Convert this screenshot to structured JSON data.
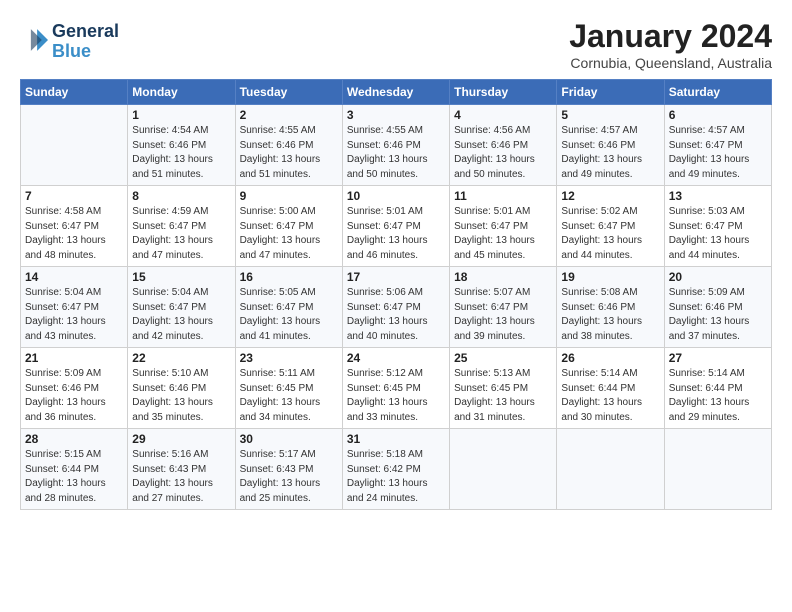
{
  "header": {
    "logo_line1": "General",
    "logo_line2": "Blue",
    "title": "January 2024",
    "subtitle": "Cornubia, Queensland, Australia"
  },
  "columns": [
    "Sunday",
    "Monday",
    "Tuesday",
    "Wednesday",
    "Thursday",
    "Friday",
    "Saturday"
  ],
  "weeks": [
    [
      {
        "day": "",
        "text": ""
      },
      {
        "day": "1",
        "text": "Sunrise: 4:54 AM\nSunset: 6:46 PM\nDaylight: 13 hours\nand 51 minutes."
      },
      {
        "day": "2",
        "text": "Sunrise: 4:55 AM\nSunset: 6:46 PM\nDaylight: 13 hours\nand 51 minutes."
      },
      {
        "day": "3",
        "text": "Sunrise: 4:55 AM\nSunset: 6:46 PM\nDaylight: 13 hours\nand 50 minutes."
      },
      {
        "day": "4",
        "text": "Sunrise: 4:56 AM\nSunset: 6:46 PM\nDaylight: 13 hours\nand 50 minutes."
      },
      {
        "day": "5",
        "text": "Sunrise: 4:57 AM\nSunset: 6:46 PM\nDaylight: 13 hours\nand 49 minutes."
      },
      {
        "day": "6",
        "text": "Sunrise: 4:57 AM\nSunset: 6:47 PM\nDaylight: 13 hours\nand 49 minutes."
      }
    ],
    [
      {
        "day": "7",
        "text": "Sunrise: 4:58 AM\nSunset: 6:47 PM\nDaylight: 13 hours\nand 48 minutes."
      },
      {
        "day": "8",
        "text": "Sunrise: 4:59 AM\nSunset: 6:47 PM\nDaylight: 13 hours\nand 47 minutes."
      },
      {
        "day": "9",
        "text": "Sunrise: 5:00 AM\nSunset: 6:47 PM\nDaylight: 13 hours\nand 47 minutes."
      },
      {
        "day": "10",
        "text": "Sunrise: 5:01 AM\nSunset: 6:47 PM\nDaylight: 13 hours\nand 46 minutes."
      },
      {
        "day": "11",
        "text": "Sunrise: 5:01 AM\nSunset: 6:47 PM\nDaylight: 13 hours\nand 45 minutes."
      },
      {
        "day": "12",
        "text": "Sunrise: 5:02 AM\nSunset: 6:47 PM\nDaylight: 13 hours\nand 44 minutes."
      },
      {
        "day": "13",
        "text": "Sunrise: 5:03 AM\nSunset: 6:47 PM\nDaylight: 13 hours\nand 44 minutes."
      }
    ],
    [
      {
        "day": "14",
        "text": "Sunrise: 5:04 AM\nSunset: 6:47 PM\nDaylight: 13 hours\nand 43 minutes."
      },
      {
        "day": "15",
        "text": "Sunrise: 5:04 AM\nSunset: 6:47 PM\nDaylight: 13 hours\nand 42 minutes."
      },
      {
        "day": "16",
        "text": "Sunrise: 5:05 AM\nSunset: 6:47 PM\nDaylight: 13 hours\nand 41 minutes."
      },
      {
        "day": "17",
        "text": "Sunrise: 5:06 AM\nSunset: 6:47 PM\nDaylight: 13 hours\nand 40 minutes."
      },
      {
        "day": "18",
        "text": "Sunrise: 5:07 AM\nSunset: 6:47 PM\nDaylight: 13 hours\nand 39 minutes."
      },
      {
        "day": "19",
        "text": "Sunrise: 5:08 AM\nSunset: 6:46 PM\nDaylight: 13 hours\nand 38 minutes."
      },
      {
        "day": "20",
        "text": "Sunrise: 5:09 AM\nSunset: 6:46 PM\nDaylight: 13 hours\nand 37 minutes."
      }
    ],
    [
      {
        "day": "21",
        "text": "Sunrise: 5:09 AM\nSunset: 6:46 PM\nDaylight: 13 hours\nand 36 minutes."
      },
      {
        "day": "22",
        "text": "Sunrise: 5:10 AM\nSunset: 6:46 PM\nDaylight: 13 hours\nand 35 minutes."
      },
      {
        "day": "23",
        "text": "Sunrise: 5:11 AM\nSunset: 6:45 PM\nDaylight: 13 hours\nand 34 minutes."
      },
      {
        "day": "24",
        "text": "Sunrise: 5:12 AM\nSunset: 6:45 PM\nDaylight: 13 hours\nand 33 minutes."
      },
      {
        "day": "25",
        "text": "Sunrise: 5:13 AM\nSunset: 6:45 PM\nDaylight: 13 hours\nand 31 minutes."
      },
      {
        "day": "26",
        "text": "Sunrise: 5:14 AM\nSunset: 6:44 PM\nDaylight: 13 hours\nand 30 minutes."
      },
      {
        "day": "27",
        "text": "Sunrise: 5:14 AM\nSunset: 6:44 PM\nDaylight: 13 hours\nand 29 minutes."
      }
    ],
    [
      {
        "day": "28",
        "text": "Sunrise: 5:15 AM\nSunset: 6:44 PM\nDaylight: 13 hours\nand 28 minutes."
      },
      {
        "day": "29",
        "text": "Sunrise: 5:16 AM\nSunset: 6:43 PM\nDaylight: 13 hours\nand 27 minutes."
      },
      {
        "day": "30",
        "text": "Sunrise: 5:17 AM\nSunset: 6:43 PM\nDaylight: 13 hours\nand 25 minutes."
      },
      {
        "day": "31",
        "text": "Sunrise: 5:18 AM\nSunset: 6:42 PM\nDaylight: 13 hours\nand 24 minutes."
      },
      {
        "day": "",
        "text": ""
      },
      {
        "day": "",
        "text": ""
      },
      {
        "day": "",
        "text": ""
      }
    ]
  ]
}
